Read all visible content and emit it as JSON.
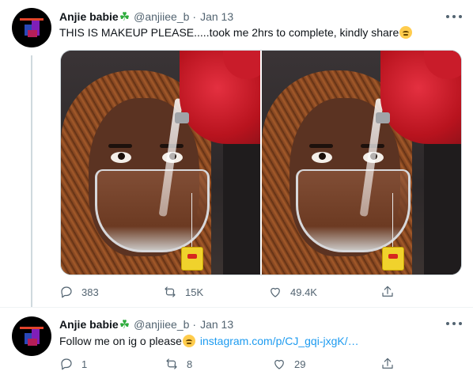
{
  "tweets": [
    {
      "name": "Anjie babie",
      "name_emoji": "☘",
      "handle": "@anjiiee_b",
      "separator": "·",
      "date": "Jan 13",
      "text": "THIS IS MAKEUP PLEASE.....took me 2hrs to complete, kindly share",
      "text_emoji": "face-with-rolling-eyes",
      "media_count": 2,
      "replies": "383",
      "retweets": "15K",
      "likes": "49.4K"
    },
    {
      "name": "Anjie babie",
      "name_emoji": "☘",
      "handle": "@anjiiee_b",
      "separator": "·",
      "date": "Jan 13",
      "text": "Follow me on ig o please",
      "text_emoji": "face-with-rolling-eyes",
      "link": "instagram.com/p/CJ_gqi-jxgK/…",
      "replies": "1",
      "retweets": "8",
      "likes": "29"
    }
  ],
  "icons": {
    "reply": "reply-icon",
    "retweet": "retweet-icon",
    "like": "heart-icon",
    "share": "share-icon",
    "more": "more-options-icon"
  },
  "colors": {
    "text": "#0f1419",
    "secondary": "#536471",
    "link": "#1d9bf0",
    "clover": "#2eac3d",
    "thread_line": "#cfd9de"
  }
}
